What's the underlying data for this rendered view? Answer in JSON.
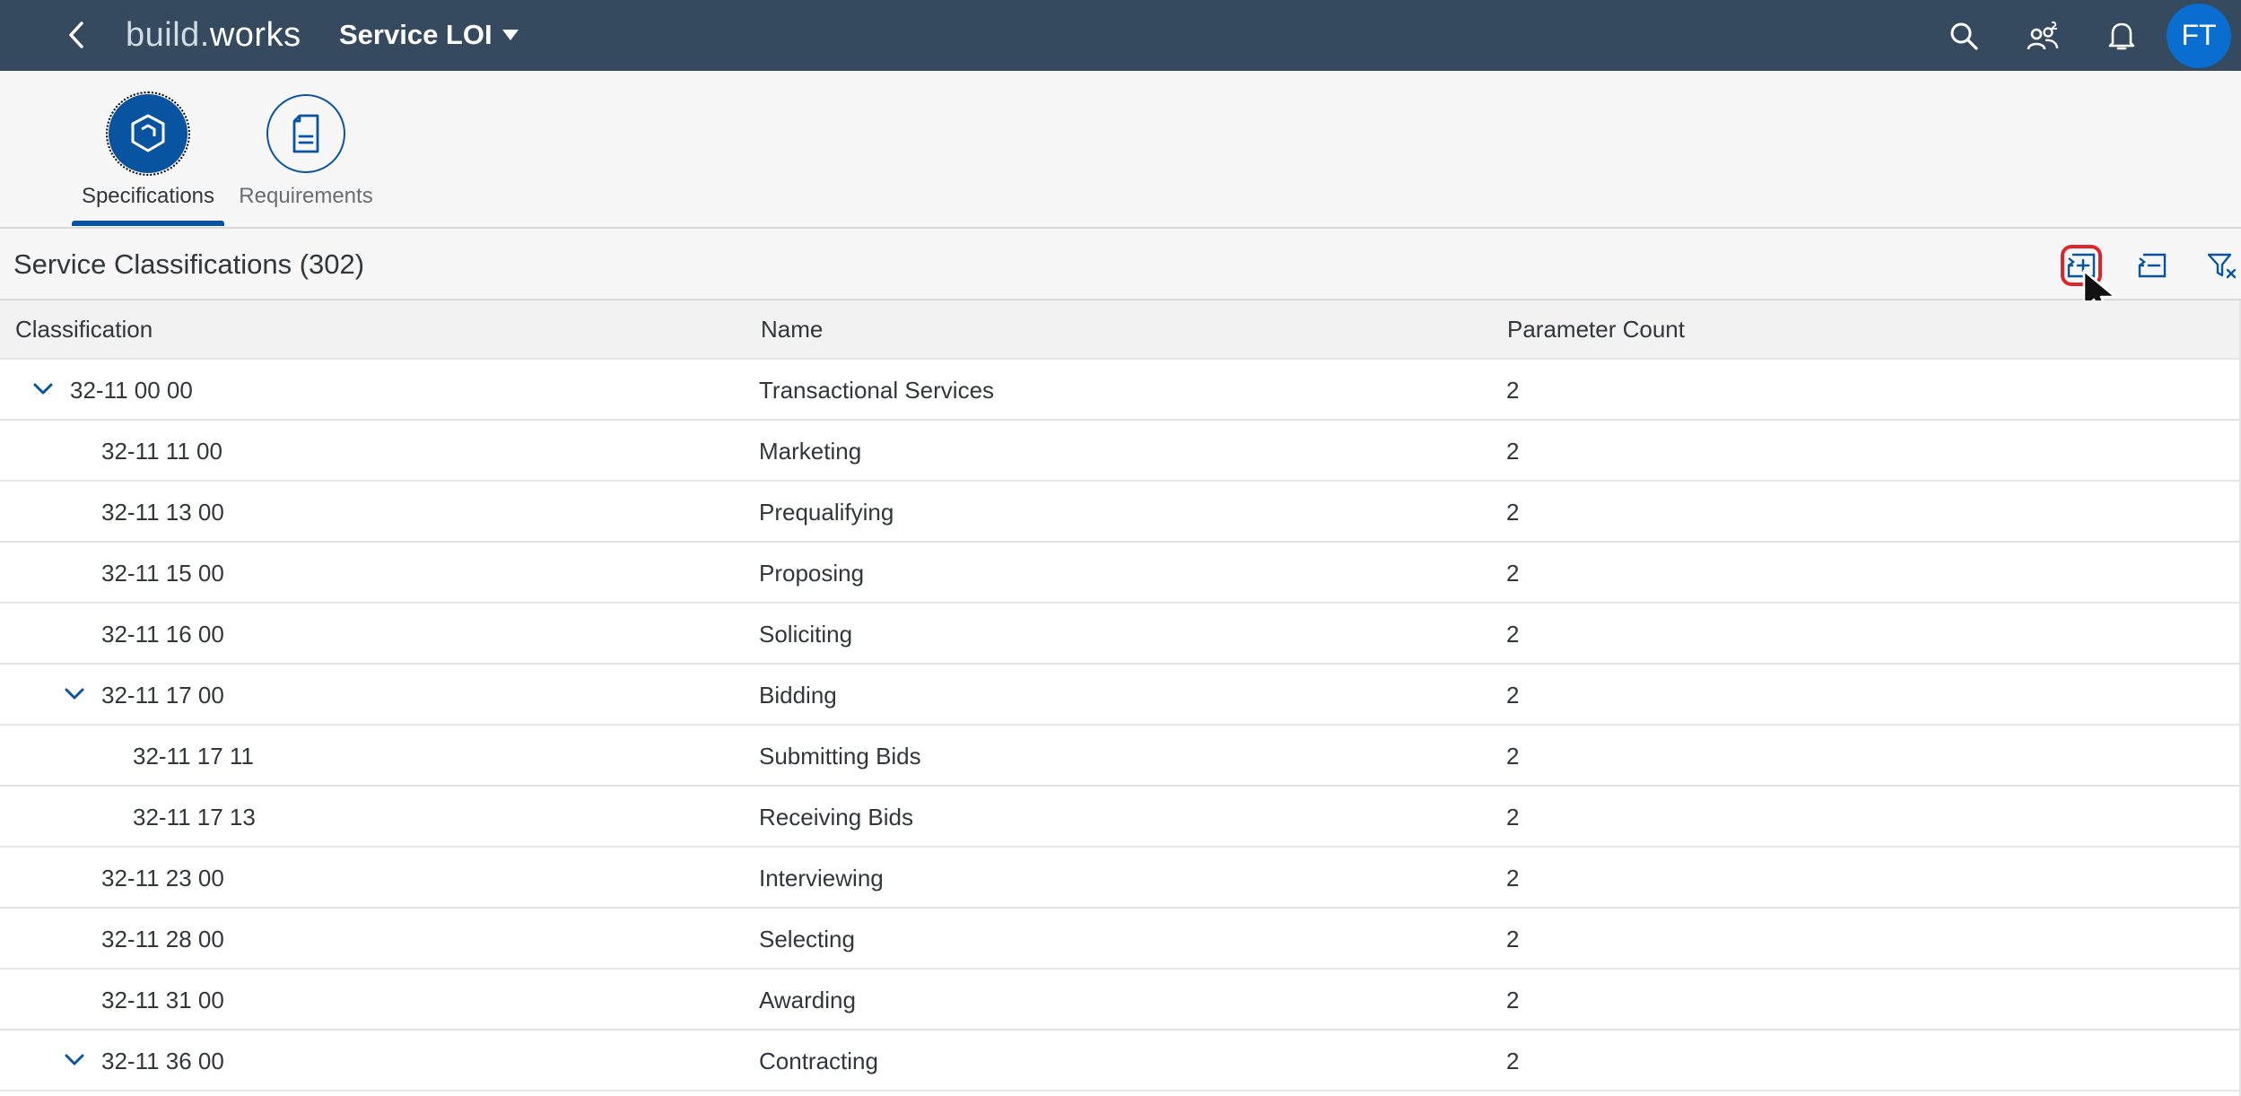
{
  "shell": {
    "brand_main": "build",
    "brand_dot": ".",
    "brand_works": "works",
    "app_title": "Service LOI",
    "user_initials": "FT",
    "icons": [
      "back-icon",
      "search-icon",
      "user-group-icon",
      "bell-icon"
    ]
  },
  "tabs": [
    {
      "label": "Specifications",
      "icon": "cube-icon",
      "selected": true
    },
    {
      "label": "Requirements",
      "icon": "document-icon",
      "selected": false
    }
  ],
  "toolbar": {
    "title": "Service Classifications (302)",
    "actions": [
      "expand-all-icon",
      "collapse-all-icon",
      "clear-filter-icon"
    ]
  },
  "table": {
    "columns": [
      "Classification",
      "Name",
      "Parameter Count"
    ],
    "rows": [
      {
        "classification": "32-11 00 00",
        "name": "Transactional Services",
        "count": "2",
        "level": 0,
        "expanded": true
      },
      {
        "classification": "32-11 11 00",
        "name": "Marketing",
        "count": "2",
        "level": 1,
        "expanded": false
      },
      {
        "classification": "32-11 13 00",
        "name": "Prequalifying",
        "count": "2",
        "level": 1,
        "expanded": false
      },
      {
        "classification": "32-11 15 00",
        "name": "Proposing",
        "count": "2",
        "level": 1,
        "expanded": false
      },
      {
        "classification": "32-11 16 00",
        "name": "Soliciting",
        "count": "2",
        "level": 1,
        "expanded": false
      },
      {
        "classification": "32-11 17 00",
        "name": "Bidding",
        "count": "2",
        "level": 1,
        "expanded": true
      },
      {
        "classification": "32-11 17 11",
        "name": "Submitting Bids",
        "count": "2",
        "level": 2,
        "expanded": false
      },
      {
        "classification": "32-11 17 13",
        "name": "Receiving Bids",
        "count": "2",
        "level": 2,
        "expanded": false
      },
      {
        "classification": "32-11 23 00",
        "name": "Interviewing",
        "count": "2",
        "level": 1,
        "expanded": false
      },
      {
        "classification": "32-11 28 00",
        "name": "Selecting",
        "count": "2",
        "level": 1,
        "expanded": false
      },
      {
        "classification": "32-11 31 00",
        "name": "Awarding",
        "count": "2",
        "level": 1,
        "expanded": false
      },
      {
        "classification": "32-11 36 00",
        "name": "Contracting",
        "count": "2",
        "level": 1,
        "expanded": true
      }
    ]
  },
  "colors": {
    "shell_bg": "#354a5f",
    "accent": "#0854a0",
    "avatar": "#0a6ed1",
    "highlight": "#e0242b"
  }
}
